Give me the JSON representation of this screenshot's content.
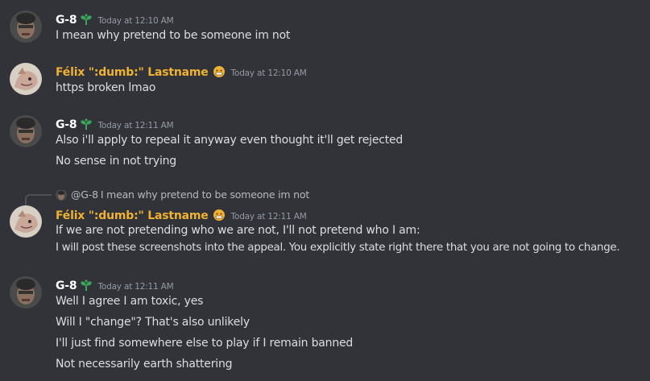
{
  "colors": {
    "background": "#313338",
    "text": "#dbdee1",
    "timestamp": "#949ba4",
    "g8_name": "#ffffff",
    "felix_name": "#f0b232",
    "badge_green": "#3ba55c"
  },
  "messages": [
    {
      "author": "G-8",
      "author_badge_icon": "sprout-icon",
      "timestamp": "Today at 12:10 AM",
      "lines": [
        "I mean why pretend to be someone im not"
      ]
    },
    {
      "author": "Félix \":dumb:\" Lastname",
      "author_badge_icon": "grimace-emoji-icon",
      "timestamp": "Today at 12:10 AM",
      "lines": [
        "https broken lmao"
      ]
    },
    {
      "author": "G-8",
      "author_badge_icon": "sprout-icon",
      "timestamp": "Today at 12:11 AM",
      "lines": [
        "Also i'll apply to repeal it anyway even thought it'll get rejected",
        "No sense in not trying"
      ]
    },
    {
      "reply": {
        "mention": "@G-8",
        "text": "I mean why pretend to be someone im not"
      },
      "author": "Félix \":dumb:\" Lastname",
      "author_badge_icon": "grimace-emoji-icon",
      "timestamp": "Today at 12:11 AM",
      "lines": [
        "If we are not pretending who we are not, I'll not pretend who I am:",
        "I will post these screenshots into the appeal. You explicitly state right there that you are not going to change."
      ]
    },
    {
      "author": "G-8",
      "author_badge_icon": "sprout-icon",
      "timestamp": "Today at 12:11 AM",
      "lines": [
        "Well I agree I am toxic, yes",
        "Will I \"change\"? That's also unlikely",
        "I'll just find somewhere else to play if I remain banned",
        "Not necessarily earth shattering"
      ]
    }
  ]
}
